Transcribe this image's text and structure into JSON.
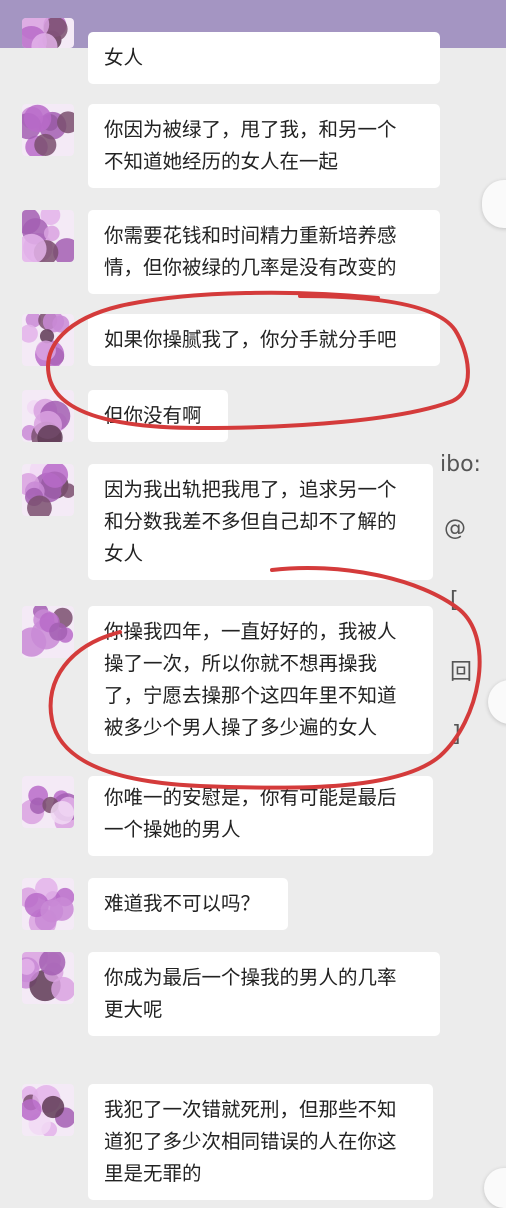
{
  "messages": [
    {
      "lines": [
        "女人"
      ]
    },
    {
      "lines": [
        "你因为被绿了，甩了我，和另一个",
        "不知道她经历的女人在一起"
      ]
    },
    {
      "lines": [
        "你需要花钱和时间精力重新培养感",
        "情，但你被绿的几率是没有改变的"
      ]
    },
    {
      "lines": [
        "如果你操腻我了，你分手就分手吧"
      ]
    },
    {
      "lines": [
        "但你没有啊"
      ]
    },
    {
      "lines": [
        "因为我出轨把我甩了，追求另一个",
        "和分数我差不多但自己却不了解的",
        "女人"
      ]
    },
    {
      "lines": [
        "你操我四年，一直好好的，我被人",
        "操了一次，所以你就不想再操我",
        "了，宁愿去操那个这四年里不知道",
        "被多少个男人操了多少遍的女人"
      ]
    },
    {
      "lines": [
        "你唯一的安慰是，你有可能是最后",
        "一个操她的男人"
      ]
    },
    {
      "lines": [
        "难道我不可以吗？"
      ]
    },
    {
      "lines": [
        "你成为最后一个操我的男人的几率",
        "更大呢"
      ]
    },
    {
      "lines": [
        "我犯了一次错就死刑，但那些不知",
        "道犯了多少次相同错误的人在你这",
        "里是无罪的"
      ]
    }
  ],
  "side_fragments": [
    "ibo:",
    "@",
    "[",
    "回",
    "]"
  ],
  "colors": {
    "header": "#a495c2",
    "annotation": "#d43b3b",
    "background": "#ececec"
  }
}
